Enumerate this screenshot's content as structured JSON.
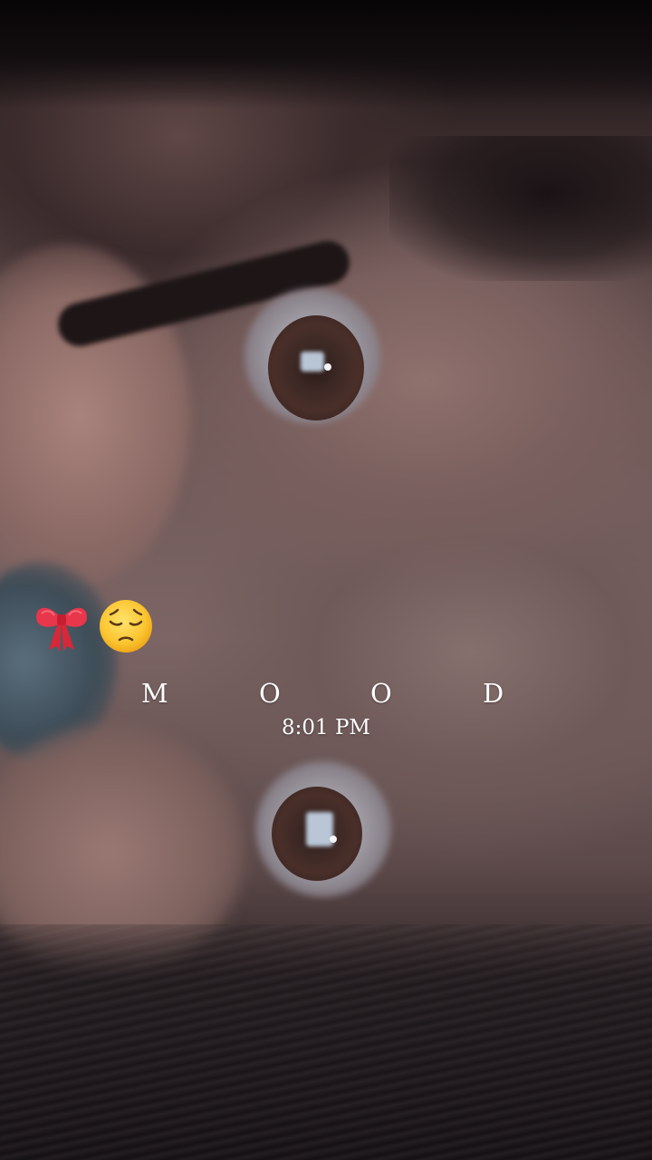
{
  "overlay": {
    "emojis": [
      "🎀",
      "😔"
    ],
    "mood_letters": [
      "M",
      "O",
      "O",
      "D"
    ],
    "time": "8:01 PM"
  }
}
